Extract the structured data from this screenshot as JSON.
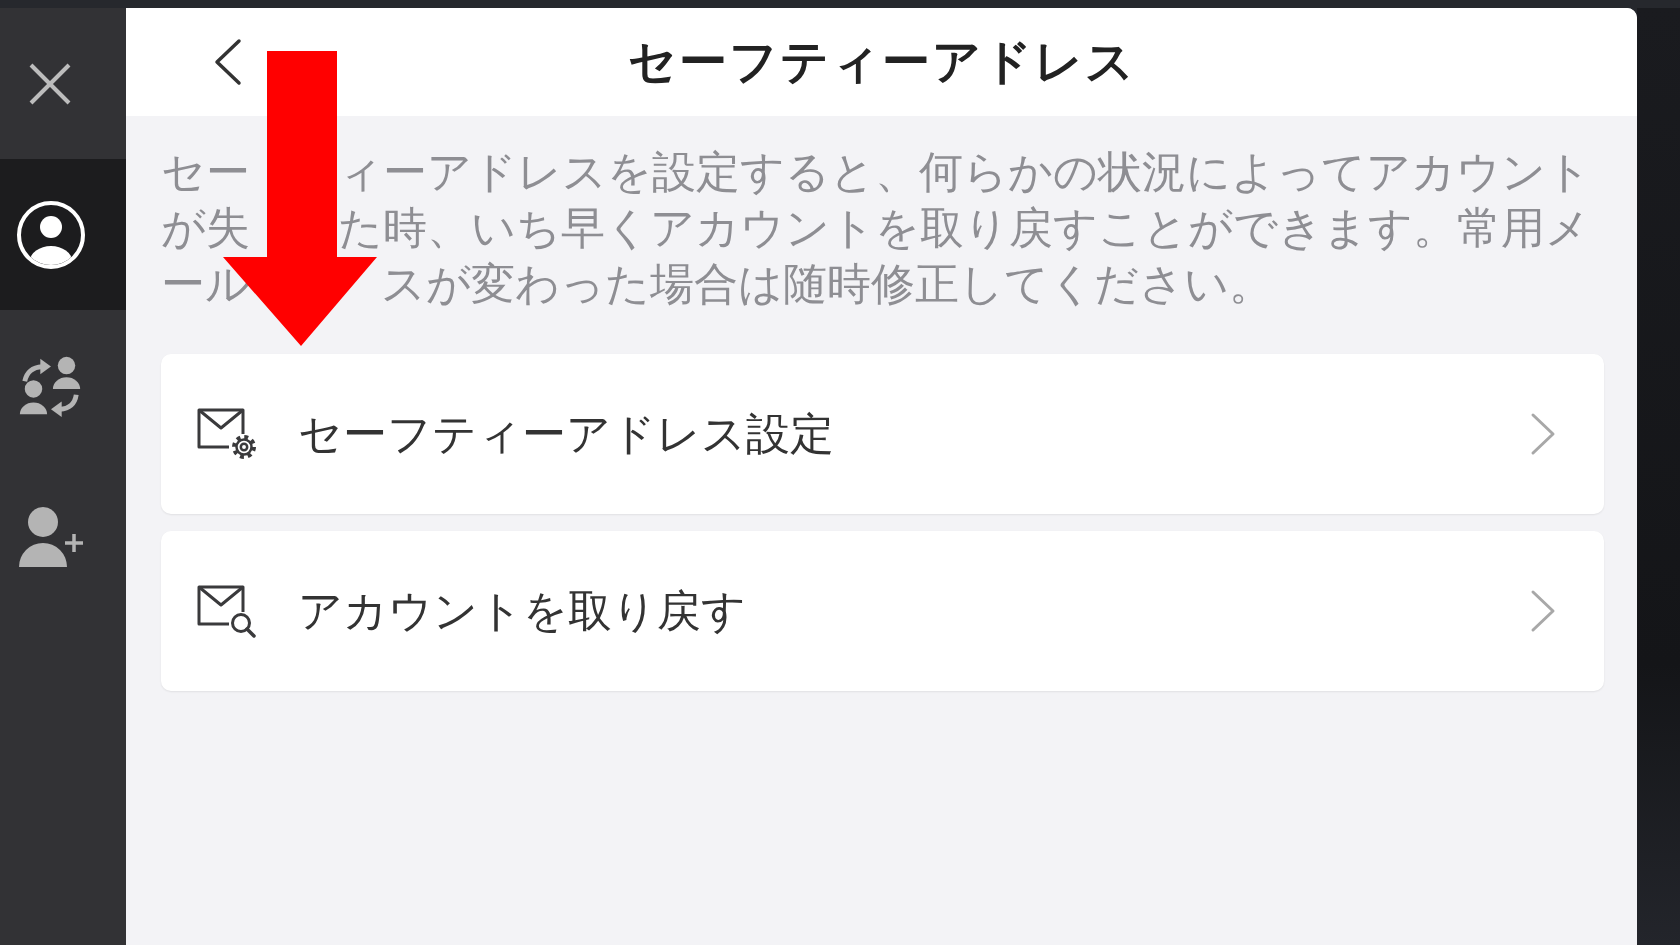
{
  "sidebar": {
    "items": [
      {
        "kind": "profile",
        "selected": true
      },
      {
        "kind": "switch",
        "selected": false
      },
      {
        "kind": "add",
        "selected": false
      }
    ]
  },
  "header": {
    "title": "セーフティーアドレス"
  },
  "description_lines": [
    [
      "セー",
      "ィーアドレスを設定すると、何らかの状況によってアカウント"
    ],
    [
      "が失",
      "た時、いち早くアカウントを取り戻すことができます。常用メ"
    ],
    [
      "ール",
      "スが変わった場合は随時修正してください。"
    ]
  ],
  "menu_items": [
    {
      "kind": "mail-settings",
      "label": "セーフティーアドレス設定"
    },
    {
      "kind": "mail-search",
      "label": "アカウントを取り戻す"
    }
  ],
  "annotation": {
    "kind": "arrow"
  }
}
